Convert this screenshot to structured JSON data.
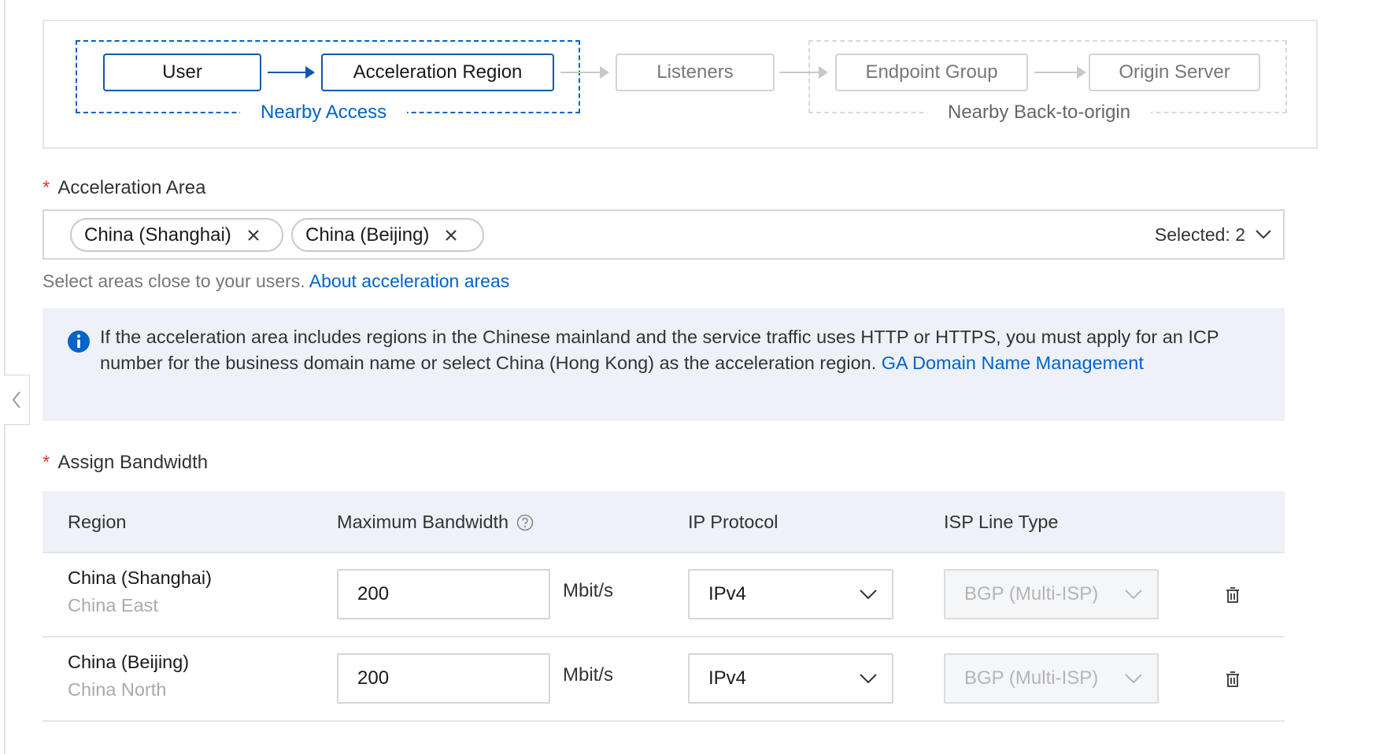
{
  "flow": {
    "nodes": {
      "user": "User",
      "acceleration_region": "Acceleration Region",
      "listeners": "Listeners",
      "endpoint_group": "Endpoint Group",
      "origin_server": "Origin Server"
    },
    "groups": {
      "nearby_access": "Nearby Access",
      "nearby_back_to_origin": "Nearby Back-to-origin"
    }
  },
  "acceleration_area": {
    "required_mark": "*",
    "label": "Acceleration Area",
    "tags": [
      "China (Shanghai)",
      "China (Beijing)"
    ],
    "selected_text": "Selected: 2",
    "hint": "Select areas close to your users.",
    "hint_link": "About acceleration areas"
  },
  "info": {
    "text": "If the acceleration area includes regions in the Chinese mainland and the service traffic uses HTTP or HTTPS, you must apply for an ICP number for the business domain name or select China (Hong Kong) as the acceleration region.",
    "link": "GA Domain Name Management"
  },
  "bandwidth": {
    "required_mark": "*",
    "label": "Assign Bandwidth",
    "columns": {
      "region": "Region",
      "max_bandwidth": "Maximum Bandwidth",
      "ip_protocol": "IP Protocol",
      "isp_line_type": "ISP Line Type"
    },
    "rows": [
      {
        "region": "China (Shanghai)",
        "area": "China East",
        "bandwidth": "200",
        "unit": "Mbit/s",
        "ip_protocol": "IPv4",
        "isp": "BGP (Multi-ISP)"
      },
      {
        "region": "China (Beijing)",
        "area": "China North",
        "bandwidth": "200",
        "unit": "Mbit/s",
        "ip_protocol": "IPv4",
        "isp": "BGP (Multi-ISP)"
      }
    ]
  },
  "colors": {
    "accent": "#0064c8",
    "required": "#e23a3a",
    "info_bg": "#eef1f8"
  },
  "icons": {
    "collapse": "chevron-left-icon",
    "tag_remove": "close-icon",
    "dropdown": "chevron-down-icon",
    "info": "info-circle-icon",
    "help": "question-circle-icon",
    "delete": "trash-icon"
  }
}
